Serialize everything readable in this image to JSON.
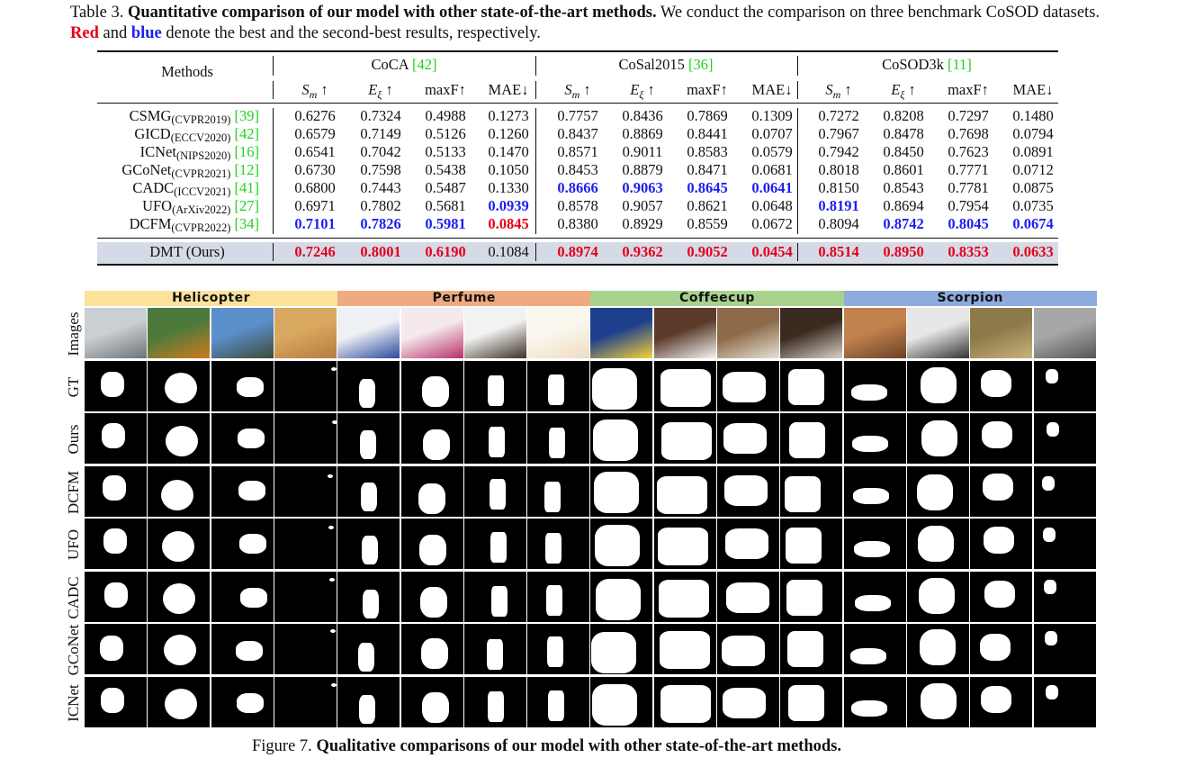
{
  "table_caption": {
    "prefix": "Table 3.",
    "bold": "Quantitative comparison of our model with other state-of-the-art methods.",
    "text1": "We conduct the comparison on three benchmark CoSOD datasets.",
    "red_word": "Red",
    "and": "and",
    "blue_word": "blue",
    "text2": "denote the best and the second-best results, respectively."
  },
  "table": {
    "methods_header": "Methods",
    "datasets": [
      {
        "name": "CoCA",
        "ref": "[42]"
      },
      {
        "name": "CoSal2015",
        "ref": "[36]"
      },
      {
        "name": "CoSOD3k",
        "ref": "[11]"
      }
    ],
    "metric_headers": [
      "S_m ↑",
      "E_ξ ↑",
      "maxF↑",
      "MAE↓"
    ],
    "rows": [
      {
        "name": "CSMG",
        "venue": "(CVPR2019)",
        "ref": "[39]",
        "values": [
          "0.6276",
          "0.7324",
          "0.4988",
          "0.1273",
          "0.7757",
          "0.8436",
          "0.7869",
          "0.1309",
          "0.7272",
          "0.8208",
          "0.7297",
          "0.1480"
        ],
        "marks": [
          "",
          "",
          "",
          "",
          "",
          "",
          "",
          "",
          "",
          "",
          "",
          ""
        ]
      },
      {
        "name": "GICD",
        "venue": "(ECCV2020)",
        "ref": "[42]",
        "values": [
          "0.6579",
          "0.7149",
          "0.5126",
          "0.1260",
          "0.8437",
          "0.8869",
          "0.8441",
          "0.0707",
          "0.7967",
          "0.8478",
          "0.7698",
          "0.0794"
        ],
        "marks": [
          "",
          "",
          "",
          "",
          "",
          "",
          "",
          "",
          "",
          "",
          "",
          ""
        ]
      },
      {
        "name": "ICNet",
        "venue": "(NIPS2020)",
        "ref": "[16]",
        "values": [
          "0.6541",
          "0.7042",
          "0.5133",
          "0.1470",
          "0.8571",
          "0.9011",
          "0.8583",
          "0.0579",
          "0.7942",
          "0.8450",
          "0.7623",
          "0.0891"
        ],
        "marks": [
          "",
          "",
          "",
          "",
          "",
          "",
          "",
          "",
          "",
          "",
          "",
          ""
        ]
      },
      {
        "name": "GCoNet",
        "venue": "(CVPR2021)",
        "ref": "[12]",
        "values": [
          "0.6730",
          "0.7598",
          "0.5438",
          "0.1050",
          "0.8453",
          "0.8879",
          "0.8471",
          "0.0681",
          "0.8018",
          "0.8601",
          "0.7771",
          "0.0712"
        ],
        "marks": [
          "",
          "",
          "",
          "",
          "",
          "",
          "",
          "",
          "",
          "",
          "",
          ""
        ]
      },
      {
        "name": "CADC",
        "venue": "(ICCV2021)",
        "ref": "[41]",
        "values": [
          "0.6800",
          "0.7443",
          "0.5487",
          "0.1330",
          "0.8666",
          "0.9063",
          "0.8645",
          "0.0641",
          "0.8150",
          "0.8543",
          "0.7781",
          "0.0875"
        ],
        "marks": [
          "",
          "",
          "",
          "",
          "second",
          "second",
          "second",
          "second",
          "",
          "",
          "",
          ""
        ]
      },
      {
        "name": "UFO",
        "venue": "(ArXiv2022)",
        "ref": "[27]",
        "values": [
          "0.6971",
          "0.7802",
          "0.5681",
          "0.0939",
          "0.8578",
          "0.9057",
          "0.8621",
          "0.0648",
          "0.8191",
          "0.8694",
          "0.7954",
          "0.0735"
        ],
        "marks": [
          "",
          "",
          "",
          "second",
          "",
          "",
          "",
          "",
          "second",
          "",
          "",
          ""
        ]
      },
      {
        "name": "DCFM",
        "venue": "(CVPR2022)",
        "ref": "[34]",
        "values": [
          "0.7101",
          "0.7826",
          "0.5981",
          "0.0845",
          "0.8380",
          "0.8929",
          "0.8559",
          "0.0672",
          "0.8094",
          "0.8742",
          "0.8045",
          "0.0674"
        ],
        "marks": [
          "second",
          "second",
          "second",
          "best",
          "",
          "",
          "",
          "",
          "",
          "second",
          "second",
          "second"
        ]
      }
    ],
    "ours": {
      "name": "DMT (Ours)",
      "values": [
        "0.7246",
        "0.8001",
        "0.6190",
        "0.1084",
        "0.8974",
        "0.9362",
        "0.9052",
        "0.0454",
        "0.8514",
        "0.8950",
        "0.8353",
        "0.0633"
      ],
      "marks": [
        "best",
        "best",
        "best",
        "",
        "best",
        "best",
        "best",
        "best",
        "best",
        "best",
        "best",
        "best"
      ]
    }
  },
  "figure": {
    "categories": [
      {
        "label": "Helicopter",
        "color": "#fbe29a"
      },
      {
        "label": "Perfume",
        "color": "#eeaa80"
      },
      {
        "label": "Coffeecup",
        "color": "#a9d18e"
      },
      {
        "label": "Scorpion",
        "color": "#8faadc"
      }
    ],
    "row_labels": [
      "Images",
      "GT",
      "Ours",
      "DCFM",
      "UFO",
      "CADC",
      "GCoNet",
      "ICNet"
    ],
    "caption_prefix": "Figure 7.",
    "caption_bold": "Qualitative comparisons of our model with other state-of-the-art methods."
  }
}
